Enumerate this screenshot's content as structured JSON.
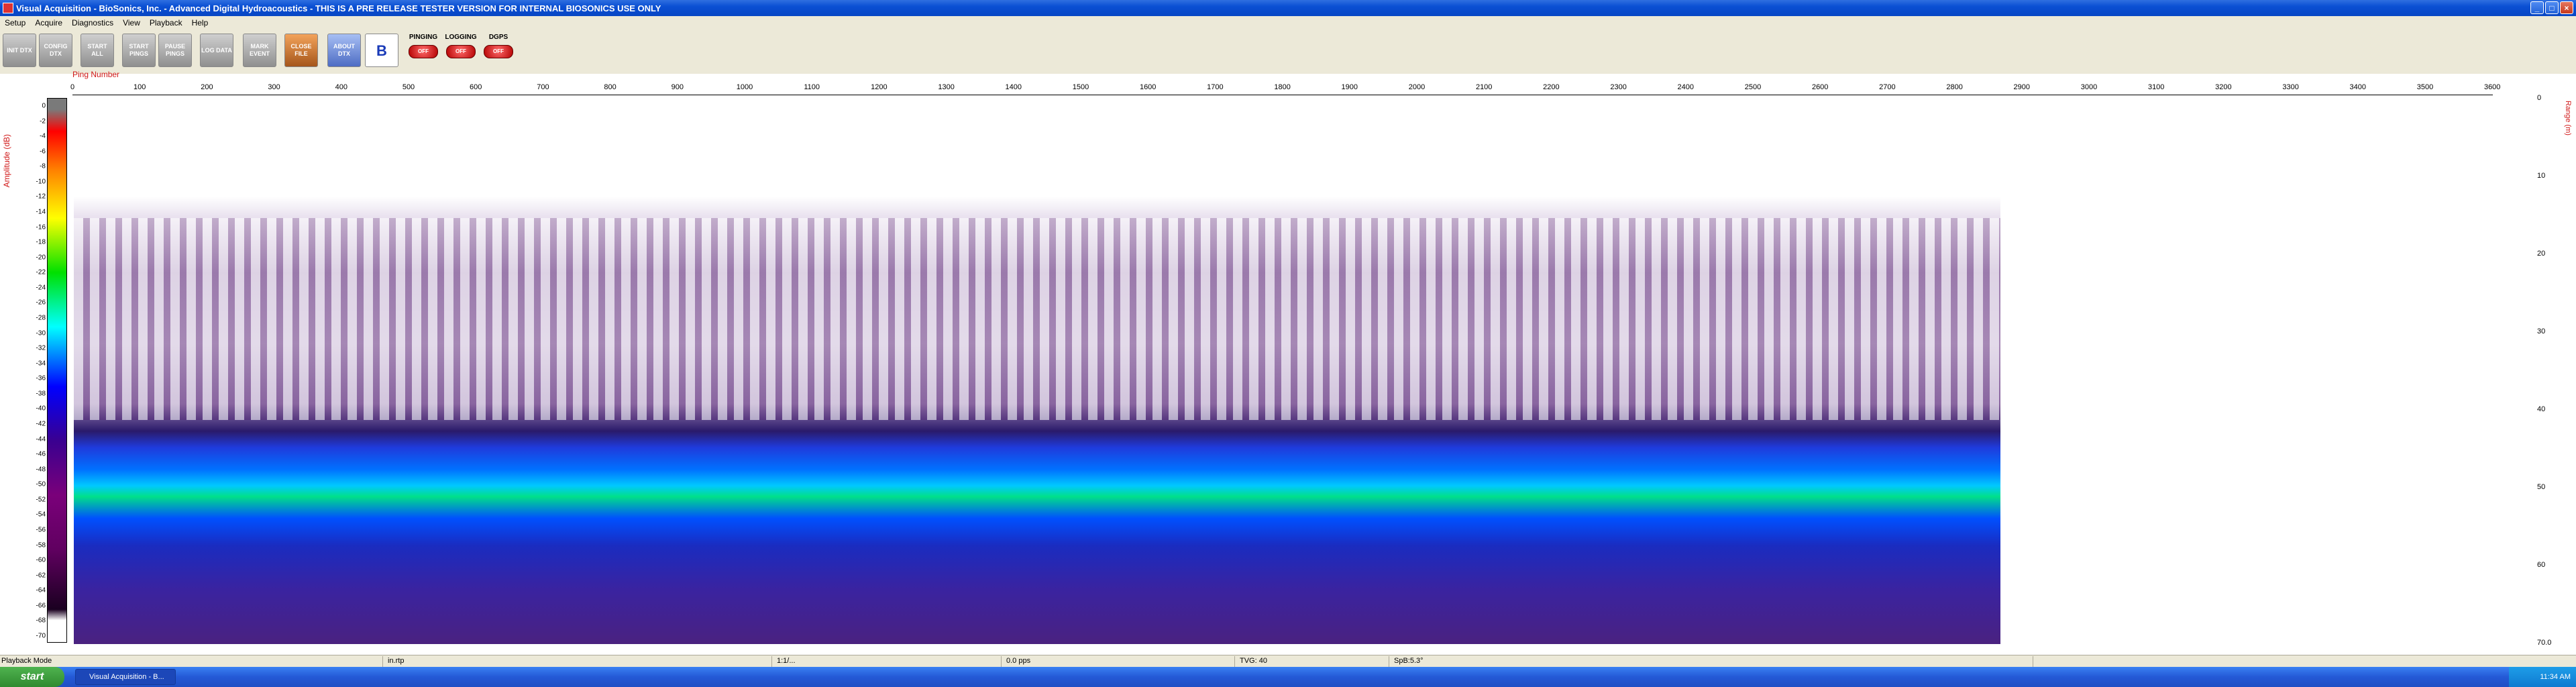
{
  "window": {
    "title": "Visual Acquisition  -  BioSonics, Inc.  -  Advanced Digital Hydroacoustics  -  THIS IS A PRE RELEASE TESTER VERSION FOR INTERNAL BIOSONICS USE ONLY",
    "min": "_",
    "max": "□",
    "close": "×"
  },
  "menu": [
    "Setup",
    "Acquire",
    "Diagnostics",
    "View",
    "Playback",
    "Help"
  ],
  "toolbar": {
    "buttons": [
      {
        "label": "INIT DTX"
      },
      {
        "label": "CONFIG DTX"
      },
      {
        "label": "START ALL"
      },
      {
        "label": "START PINGS"
      },
      {
        "label": "PAUSE PINGS"
      },
      {
        "label": "LOG DATA"
      },
      {
        "label": "MARK EVENT"
      },
      {
        "label": "CLOSE FILE"
      },
      {
        "label": "ABOUT DTX"
      },
      {
        "label": "B"
      }
    ],
    "indicators": [
      {
        "label": "PINGING",
        "state": "OFF"
      },
      {
        "label": "LOGGING",
        "state": "OFF"
      },
      {
        "label": "DGPS",
        "state": "OFF"
      }
    ]
  },
  "echogram": {
    "x_axis_label": "Ping Number",
    "x_ticks": [
      "0",
      "100",
      "200",
      "300",
      "400",
      "500",
      "600",
      "700",
      "800",
      "900",
      "1000",
      "1100",
      "1200",
      "1300",
      "1400",
      "1500",
      "1600",
      "1700",
      "1800",
      "1900",
      "2000",
      "2100",
      "2200",
      "2300",
      "2400",
      "2500",
      "2600",
      "2700",
      "2800",
      "2900",
      "3000",
      "3100",
      "3200",
      "3300",
      "3400",
      "3500",
      "3600"
    ],
    "amplitude_label": "Amplitude (dB)",
    "amplitude_ticks": [
      "0",
      "-2",
      "-4",
      "-6",
      "-8",
      "-10",
      "-12",
      "-14",
      "-16",
      "-18",
      "-20",
      "-22",
      "-24",
      "-26",
      "-28",
      "-30",
      "-32",
      "-34",
      "-36",
      "-38",
      "-40",
      "-42",
      "-44",
      "-46",
      "-48",
      "-50",
      "-52",
      "-54",
      "-56",
      "-58",
      "-60",
      "-62",
      "-64",
      "-66",
      "-68",
      "-70"
    ],
    "range_label": "Range (m)",
    "range_ticks": [
      "0",
      "10",
      "20",
      "30",
      "40",
      "50",
      "60",
      "70.0"
    ]
  },
  "status": {
    "mode": "Playback Mode",
    "file": "in.rtp",
    "c1": "1:1/...",
    "rate": "0.0 pps",
    "tvg": "TVG: 40",
    "spb": "SpB:5.3°"
  },
  "taskbar": {
    "start": "start",
    "task": "Visual Acquisition - B...",
    "clock": "11:34 AM"
  }
}
